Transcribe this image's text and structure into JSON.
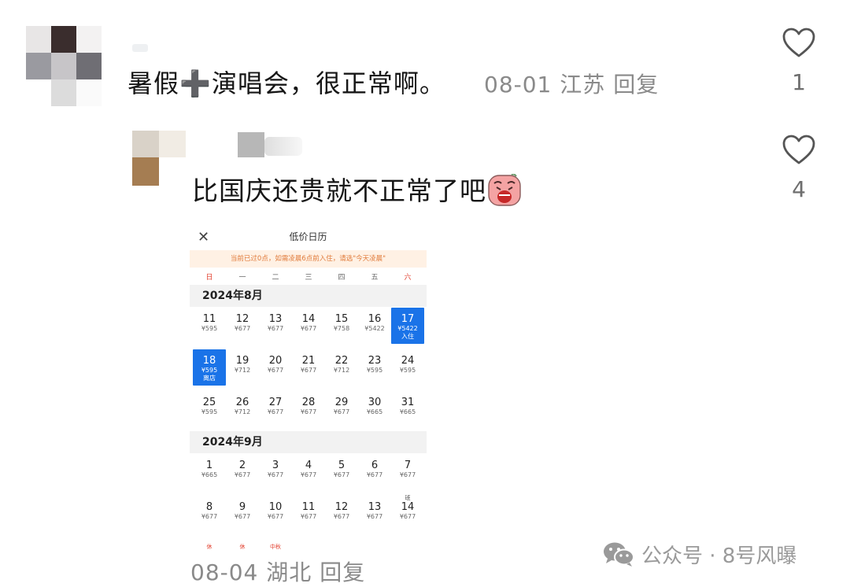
{
  "comments": [
    {
      "text_a": "暑假",
      "text_plus": "➕",
      "text_b": "演唱会，很正常啊。",
      "date": "08-01",
      "location": "江苏",
      "reply": "回复",
      "likes": "1"
    },
    {
      "text": "比国庆还贵就不正常了吧",
      "emoji": "crying-face-emoji",
      "date": "08-04",
      "location": "湖北",
      "reply": "回复",
      "likes": "4"
    }
  ],
  "calendar": {
    "close": "✕",
    "title": "低价日历",
    "notice": "当前已过0点，如需凌晨6点前入住，请选\"今天凌晨\"",
    "weekdays": [
      "日",
      "一",
      "二",
      "三",
      "四",
      "五",
      "六"
    ],
    "months": [
      {
        "label": "2024年8月",
        "weeks": [
          [
            {
              "d": "11",
              "p": "¥595"
            },
            {
              "d": "12",
              "p": "¥677"
            },
            {
              "d": "13",
              "p": "¥677"
            },
            {
              "d": "14",
              "p": "¥677"
            },
            {
              "d": "15",
              "p": "¥758"
            },
            {
              "d": "16",
              "p": "¥5422"
            },
            {
              "d": "17",
              "p": "¥5422",
              "tag": "入住",
              "selected": true
            }
          ],
          [
            {
              "d": "18",
              "p": "¥595",
              "tag": "离店",
              "selected": true
            },
            {
              "d": "19",
              "p": "¥712"
            },
            {
              "d": "20",
              "p": "¥677"
            },
            {
              "d": "21",
              "p": "¥677"
            },
            {
              "d": "22",
              "p": "¥712"
            },
            {
              "d": "23",
              "p": "¥595"
            },
            {
              "d": "24",
              "p": "¥595"
            }
          ],
          [
            {
              "d": "25",
              "p": "¥595"
            },
            {
              "d": "26",
              "p": "¥712"
            },
            {
              "d": "27",
              "p": "¥677"
            },
            {
              "d": "28",
              "p": "¥677"
            },
            {
              "d": "29",
              "p": "¥677"
            },
            {
              "d": "30",
              "p": "¥665"
            },
            {
              "d": "31",
              "p": "¥665"
            }
          ]
        ]
      },
      {
        "label": "2024年9月",
        "weeks": [
          [
            {
              "d": "1",
              "p": "¥665"
            },
            {
              "d": "2",
              "p": "¥677"
            },
            {
              "d": "3",
              "p": "¥677"
            },
            {
              "d": "4",
              "p": "¥677"
            },
            {
              "d": "5",
              "p": "¥677"
            },
            {
              "d": "6",
              "p": "¥677"
            },
            {
              "d": "7",
              "p": "¥677"
            }
          ],
          [
            {
              "d": "8",
              "p": "¥677"
            },
            {
              "d": "9",
              "p": "¥677"
            },
            {
              "d": "10",
              "p": "¥677"
            },
            {
              "d": "11",
              "p": "¥677"
            },
            {
              "d": "12",
              "p": "¥677"
            },
            {
              "d": "13",
              "p": "¥677"
            },
            {
              "d": "14",
              "p": "¥677",
              "top": "班"
            }
          ]
        ]
      }
    ],
    "next_row_marks": [
      "休",
      "休",
      "中秋"
    ]
  },
  "watermark": {
    "icon": "wechat-icon",
    "text": "公众号 · 8号风曝"
  },
  "colors": {
    "accent_blue": "#1a73e8",
    "meta_gray": "#8a8a8a",
    "notice_orange": "#e07a3a",
    "holiday_red": "#e2402f"
  }
}
